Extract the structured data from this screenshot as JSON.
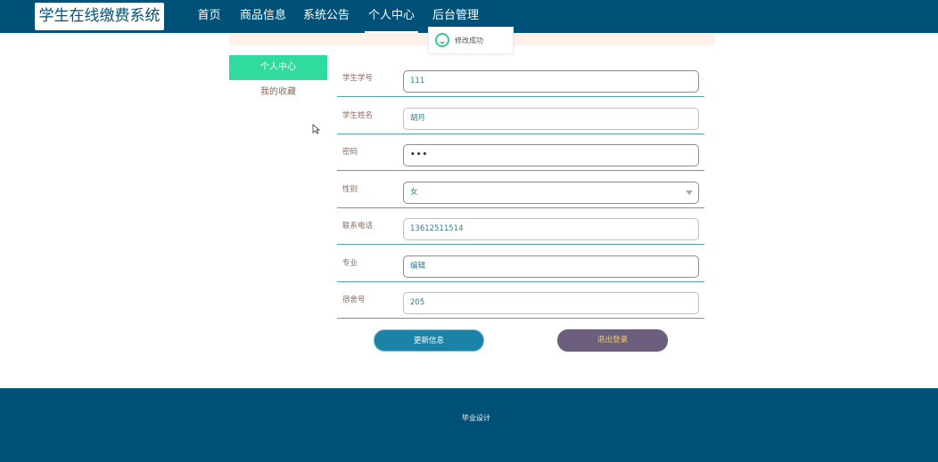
{
  "header": {
    "logo": "学生在线缴费系统",
    "nav": [
      "首页",
      "商品信息",
      "系统公告",
      "个人中心",
      "后台管理"
    ],
    "active_nav": "个人中心"
  },
  "toast": {
    "message": "修改成功",
    "icon": "smile-icon"
  },
  "sidebar": {
    "items": [
      {
        "label": "个人中心",
        "active": true
      },
      {
        "label": "我的收藏",
        "active": false
      }
    ]
  },
  "form": {
    "fields": [
      {
        "label": "学生学号",
        "value": "111"
      },
      {
        "label": "学生姓名",
        "value": "胡月"
      },
      {
        "label": "密码",
        "value": "•••"
      },
      {
        "label": "性别",
        "value": "女"
      },
      {
        "label": "联系电话",
        "value": "13612511514"
      },
      {
        "label": "专业",
        "value": "编辑"
      },
      {
        "label": "宿舍号",
        "value": "205"
      }
    ]
  },
  "buttons": {
    "update": "更新信息",
    "logout": "退出登录"
  },
  "footer": {
    "text": "毕业设计"
  },
  "colors": {
    "primary": "#005177",
    "accent": "#2fdc9e",
    "update_button": "#1b82a8",
    "logout_button": "#6c5f7e"
  }
}
